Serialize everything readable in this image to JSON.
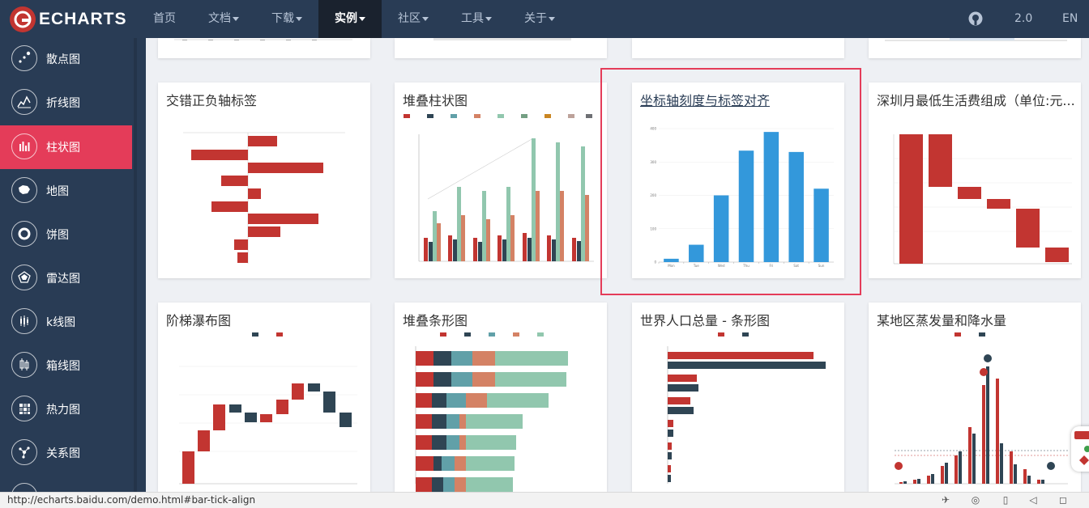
{
  "nav": {
    "brand": "ECHARTS",
    "items": [
      {
        "label": "首页",
        "caret": false
      },
      {
        "label": "文档",
        "caret": true
      },
      {
        "label": "下载",
        "caret": true
      },
      {
        "label": "实例",
        "caret": true
      },
      {
        "label": "社区",
        "caret": true
      },
      {
        "label": "工具",
        "caret": true
      },
      {
        "label": "关于",
        "caret": true
      }
    ],
    "version": "2.0",
    "lang": "EN"
  },
  "sidebar": {
    "items": [
      {
        "label": "散点图",
        "icon": "scatter-icon"
      },
      {
        "label": "折线图",
        "icon": "line-chart-icon"
      },
      {
        "label": "柱状图",
        "icon": "bar-chart-icon"
      },
      {
        "label": "地图",
        "icon": "map-icon"
      },
      {
        "label": "饼图",
        "icon": "pie-chart-icon"
      },
      {
        "label": "雷达图",
        "icon": "radar-icon"
      },
      {
        "label": "k线图",
        "icon": "candlestick-icon"
      },
      {
        "label": "箱线图",
        "icon": "boxplot-icon"
      },
      {
        "label": "热力图",
        "icon": "heatmap-icon"
      },
      {
        "label": "关系图",
        "icon": "graph-icon"
      }
    ]
  },
  "cards": [
    {
      "title": "交错正负轴标签"
    },
    {
      "title": "堆叠柱状图"
    },
    {
      "title": "坐标轴刻度与标签对齐"
    },
    {
      "title": "深圳月最低生活费组成（单位:元..."
    },
    {
      "title": "阶梯瀑布图"
    },
    {
      "title": "堆叠条形图"
    },
    {
      "title": "世界人口总量 - 条形图"
    },
    {
      "title": "某地区蒸发量和降水量"
    }
  ],
  "chart_data": {
    "type": "bar",
    "categories": [
      "Mon",
      "Tue",
      "Wed",
      "Thu",
      "Fri",
      "Sat",
      "Sun"
    ],
    "values": [
      10,
      52,
      200,
      334,
      390,
      330,
      220
    ],
    "ylim": [
      0,
      400
    ],
    "yticks": [
      "0",
      "100",
      "200",
      "300",
      "400"
    ],
    "color": "#3398db"
  },
  "status": {
    "url": "http://echarts.baidu.com/demo.html#bar-tick-align"
  },
  "colors": {
    "nav_bg": "#293c55",
    "accent": "#e43c59",
    "red": "#c23531",
    "navy": "#2f4554",
    "teal": "#61a0a8",
    "orange": "#d48265",
    "mint": "#91c7ae",
    "blue": "#3398db"
  }
}
